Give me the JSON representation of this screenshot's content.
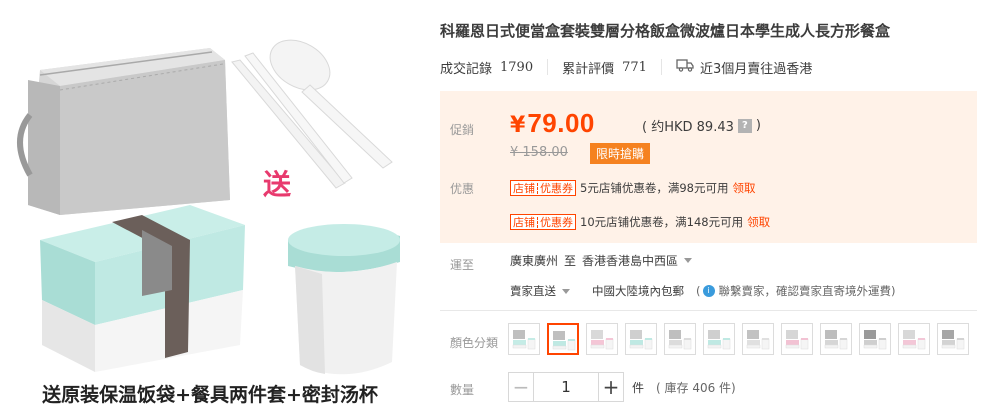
{
  "product": {
    "title": "科羅恩日式便當盒套裝雙層分格飯盒微波爐日本學生成人長方形餐盒",
    "image_caption": "送原装保温饭袋+餐具两件套+密封汤杯",
    "gift_badge": "送"
  },
  "stats": {
    "deals_label": "成交記錄",
    "deals_count": "1790",
    "reviews_label": "累計評價",
    "reviews_count": "771",
    "shipping_note": "近3個月賣往過香港"
  },
  "price": {
    "label": "促銷",
    "currency": "¥",
    "amount": "79.00",
    "hkd": "( 约HKD 89.43",
    "hkd_close": ")",
    "help_icon": "?",
    "original": "¥ 158.00",
    "limited_badge": "限時搶購"
  },
  "promotions": {
    "label": "优惠",
    "coupons": [
      {
        "tag_left": "店铺",
        "tag_right": "优惠券",
        "text": "5元店铺优惠卷，满98元可用",
        "claim": "领取"
      },
      {
        "tag_left": "店铺",
        "tag_right": "优惠券",
        "text": "10元店铺优惠卷，满148元可用",
        "claim": "领取"
      }
    ]
  },
  "shipping": {
    "label": "運至",
    "from": "廣東廣州",
    "to_word": "至",
    "destination": "香港香港島中西區",
    "method": "賣家直送",
    "free_shipping": "中國大陸境內包郵",
    "paren_open": "(",
    "info_badge": "i",
    "note": "聯繫賣家，確認賣家直寄境外運費)"
  },
  "color": {
    "label": "顏色分類",
    "selected_index": 1,
    "swatches": [
      "gray-blue",
      "gray-blue-selected",
      "pink",
      "mint",
      "gray",
      "mint-2",
      "gray-2",
      "pink-2",
      "gray-3",
      "gray-4",
      "pink-3",
      "gray-5"
    ]
  },
  "quantity": {
    "label": "數量",
    "minus": "−",
    "value": "1",
    "plus": "+",
    "unit": "件",
    "stock": "( 庫存 406 件)"
  },
  "colors": {
    "accent": "#ff4400",
    "promo_bg": "#fff2e8",
    "badge_orange": "#f58220",
    "lunchbox_mint": "#bfe9e3"
  }
}
